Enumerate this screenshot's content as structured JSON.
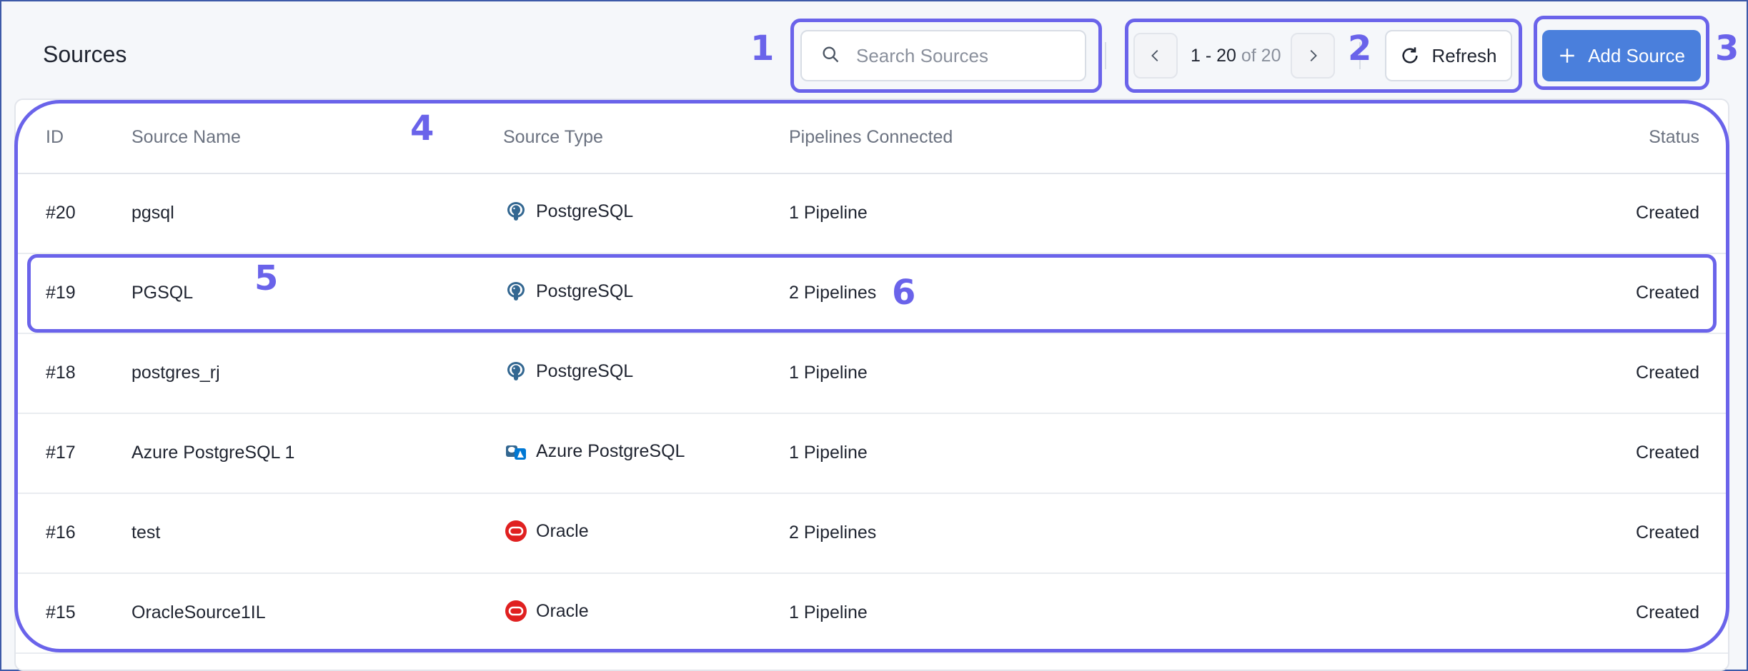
{
  "header": {
    "title": "Sources"
  },
  "search": {
    "placeholder": "Search Sources",
    "value": ""
  },
  "pagination": {
    "range": "1 - 20",
    "of_text": "of 20"
  },
  "toolbar": {
    "refresh_label": "Refresh",
    "add_label": "Add Source"
  },
  "table": {
    "columns": {
      "id": "ID",
      "name": "Source Name",
      "type": "Source Type",
      "pipelines": "Pipelines Connected",
      "status": "Status"
    },
    "rows": [
      {
        "id": "#20",
        "name": "pgsql",
        "type": "PostgreSQL",
        "type_icon": "postgresql-icon",
        "pipelines": "1 Pipeline",
        "status": "Created"
      },
      {
        "id": "#19",
        "name": "PGSQL",
        "type": "PostgreSQL",
        "type_icon": "postgresql-icon",
        "pipelines": "2 Pipelines",
        "status": "Created"
      },
      {
        "id": "#18",
        "name": "postgres_rj",
        "type": "PostgreSQL",
        "type_icon": "postgresql-icon",
        "pipelines": "1 Pipeline",
        "status": "Created"
      },
      {
        "id": "#17",
        "name": "Azure PostgreSQL 1",
        "type": "Azure PostgreSQL",
        "type_icon": "azure-postgresql-icon",
        "pipelines": "1 Pipeline",
        "status": "Created"
      },
      {
        "id": "#16",
        "name": "test",
        "type": "Oracle",
        "type_icon": "oracle-icon",
        "pipelines": "2 Pipelines",
        "status": "Created"
      },
      {
        "id": "#15",
        "name": "OracleSource1IL",
        "type": "Oracle",
        "type_icon": "oracle-icon",
        "pipelines": "1 Pipeline",
        "status": "Created"
      }
    ]
  },
  "callouts": [
    "1",
    "2",
    "3",
    "4",
    "5",
    "6"
  ],
  "colors": {
    "accent": "#4a7fdc",
    "callout": "#6a63ea",
    "oracle": "#e02020",
    "postgres": "#336791"
  }
}
